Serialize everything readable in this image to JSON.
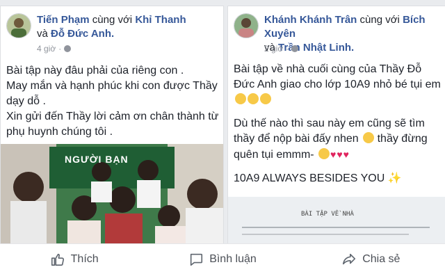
{
  "post_left": {
    "author": "Tiến Phạm",
    "with_text": "cùng với",
    "tagged_1": "Khỉ Thanh",
    "and_text": "và",
    "tagged_2": "Đỗ Đức Anh.",
    "time": "4 giờ",
    "lines": [
      "Bài tập này đâu phải của riêng con .",
      "May mắn và hạnh phúc khi con được Thầy dạy dỗ .",
      "Xin gửi đến Thầy lời cảm ơn chân thành từ phụ huynh chúng tôi ."
    ],
    "photo_sign_text": "NGƯỜI BẠN"
  },
  "post_right": {
    "author": "Khánh Khánh Trân",
    "with_text": "cùng với",
    "tagged_1": "Bích Xuyên",
    "and_text": "và",
    "tagged_2": "Trần Nhật Linh.",
    "time": "2 giờ",
    "paragraph_1": "Bài tập về nhà cuối cùng của Thầy Đỗ Đức Anh giao cho lớp 10A9 nhỏ bé tụi em",
    "paragraph_2": "Dù thế nào thì sau này em cũng sẽ tìm thầy để nộp bài đấy nhen",
    "paragraph_2b": "thầy đừng quên tụi emmm-",
    "paragraph_3": "10A9 ALWAYS BESIDES YOU",
    "sparkle": "✨",
    "paper_title": "BÀI TẬP VỀ NHÀ"
  },
  "actions": {
    "like_label": "Thích",
    "comment_label": "Bình luận",
    "share_label": "Chia sẻ"
  }
}
